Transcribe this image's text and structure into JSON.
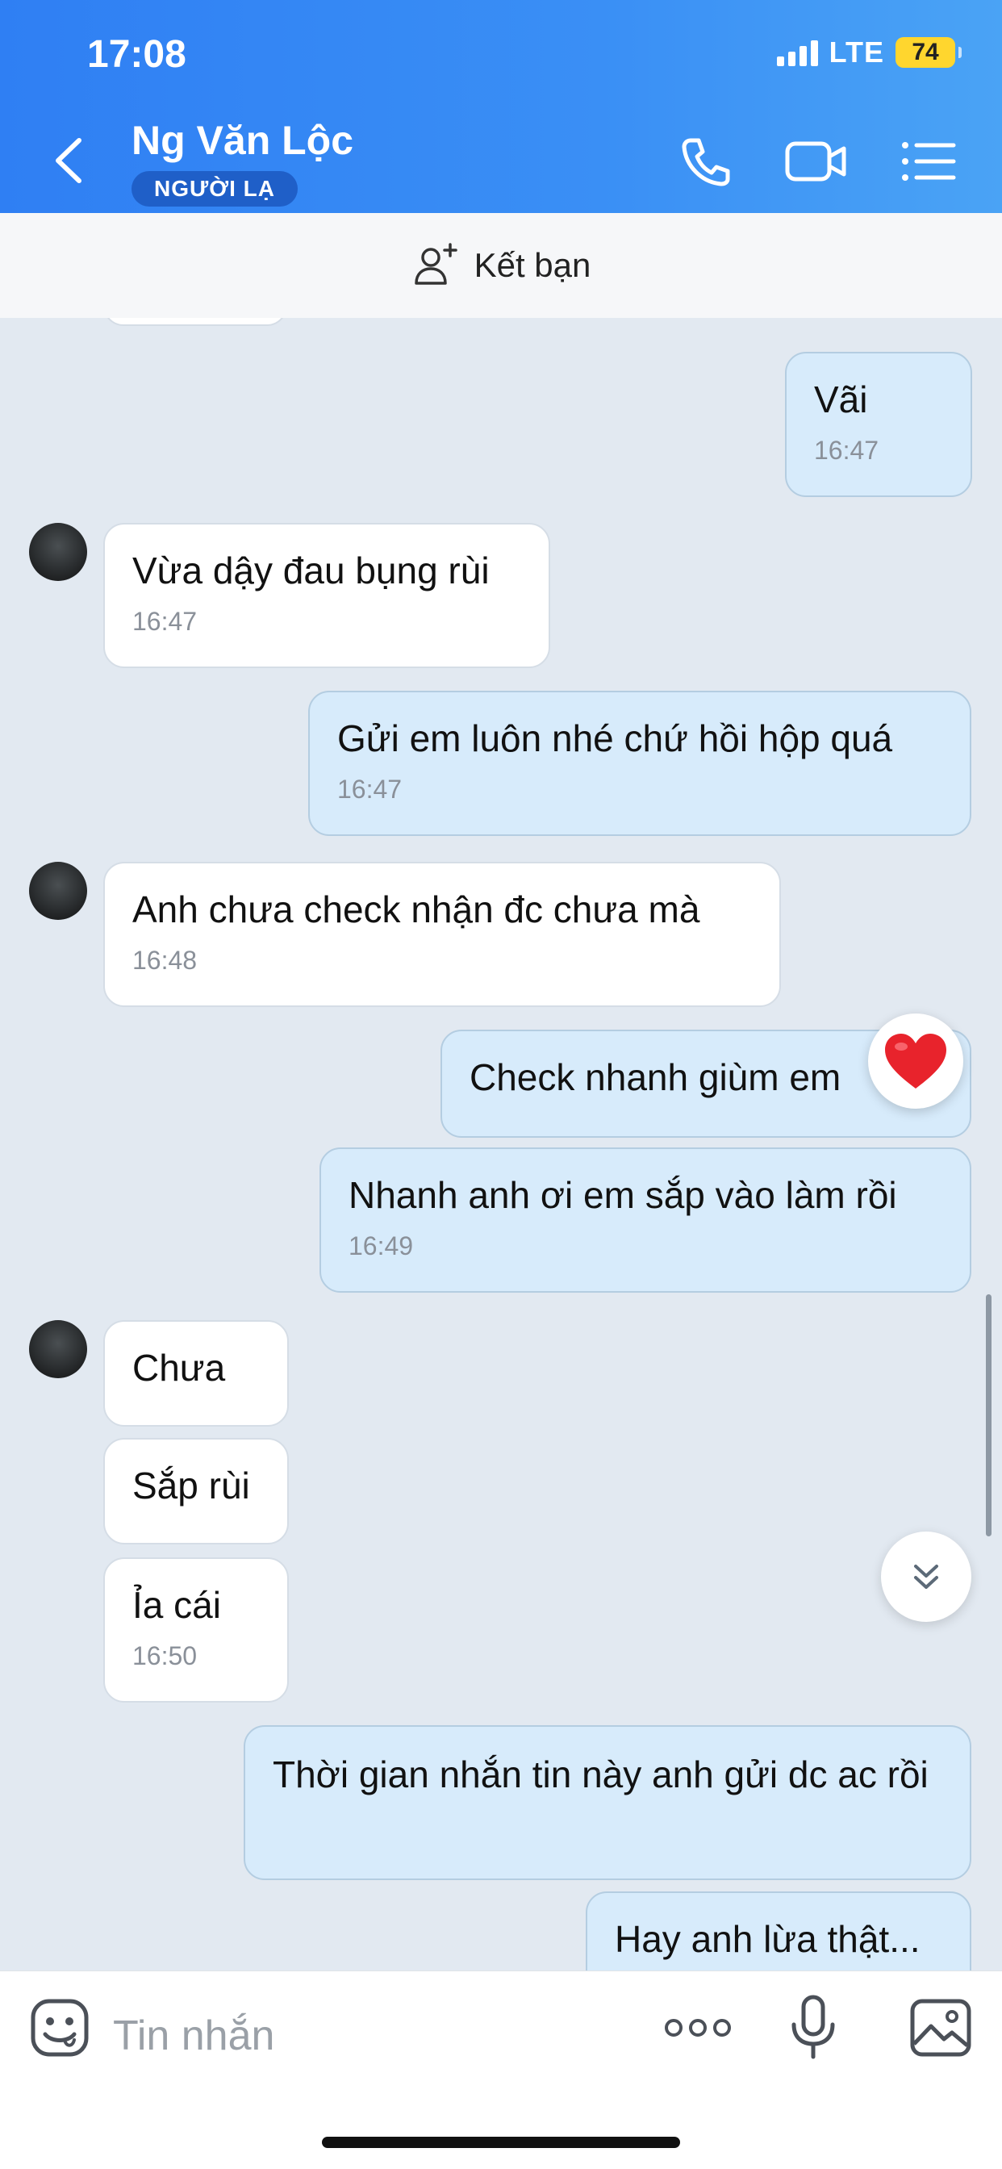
{
  "status": {
    "time": "17:08",
    "network": "LTE",
    "battery": "74"
  },
  "header": {
    "name": "Ng Văn Lộc",
    "badge": "NGƯỜI LẠ",
    "icons": [
      "chevron-left-icon",
      "phone-icon",
      "video-camera-icon",
      "menu-list-icon"
    ]
  },
  "add_friend": {
    "label": "Kết bạn",
    "icon": "add-user-icon"
  },
  "messages": [
    {
      "dir": "out",
      "text": "Vãi",
      "time": "16:47"
    },
    {
      "dir": "in",
      "text": "Vừa dậy đau bụng rùi",
      "time": "16:47"
    },
    {
      "dir": "out",
      "text": "Gửi em luôn nhé chứ hồi hộp quá",
      "time": "16:47"
    },
    {
      "dir": "in",
      "text": "Anh chưa check nhận đc chưa mà",
      "time": "16:48"
    },
    {
      "dir": "out",
      "text": "Check nhanh giùm em",
      "time": "",
      "reaction": "heart"
    },
    {
      "dir": "out",
      "text": "Nhanh anh ơi em sắp vào làm rồi",
      "time": "16:49"
    },
    {
      "dir": "in",
      "text": "Chưa",
      "time": ""
    },
    {
      "dir": "in",
      "text": "Sắp rùi",
      "time": ""
    },
    {
      "dir": "in",
      "text": "Ỉa cái",
      "time": "16:50"
    },
    {
      "dir": "out",
      "text": "Thời gian nhắn tin này anh gửi dc ac rồi",
      "time": ""
    },
    {
      "dir": "out",
      "text": "Hay anh lừa thật...",
      "time": ""
    }
  ],
  "input": {
    "placeholder": "Tin nhắn",
    "icons": [
      "sticker-icon",
      "more-icon",
      "microphone-icon",
      "image-icon"
    ]
  },
  "colors": {
    "header_blue": "#3a8ff5",
    "outgoing_bubble": "#d7ebfb",
    "incoming_bubble": "#ffffff",
    "chat_bg": "#e2e9f1"
  }
}
